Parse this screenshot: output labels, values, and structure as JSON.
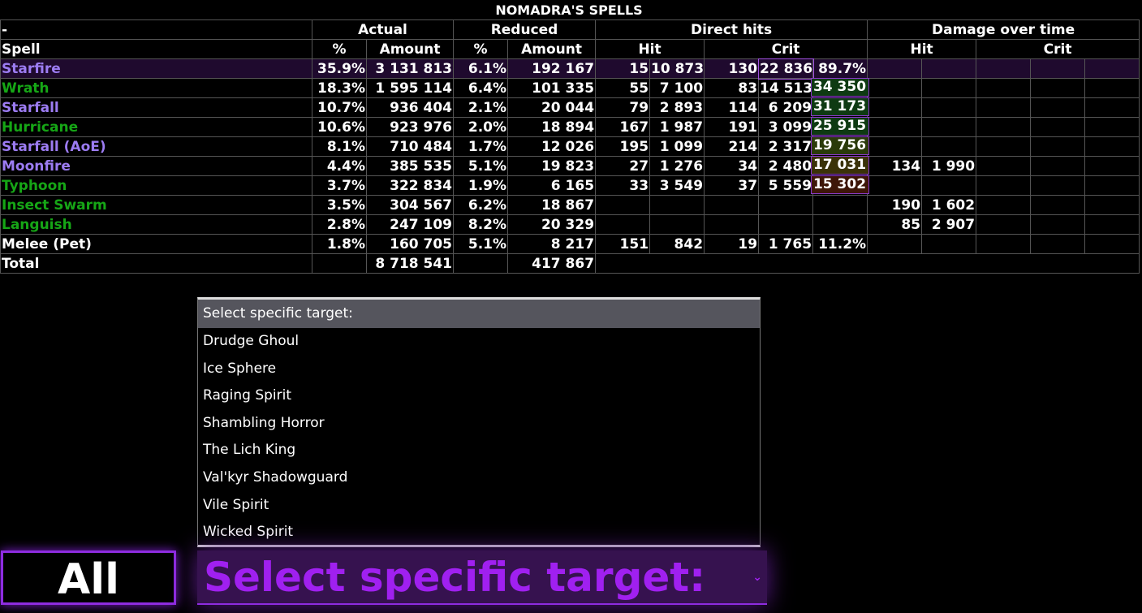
{
  "title": "NOMADRA'S SPELLS",
  "groups": {
    "dash": "-",
    "actual": "Actual",
    "reduced": "Reduced",
    "direct_hits": "Direct hits",
    "dot": "Damage over time"
  },
  "subheaders": {
    "spell": "Spell",
    "pct": "%",
    "amount": "Amount",
    "pct2": "%",
    "amount2": "Amount",
    "hit": "Hit",
    "crit": "Crit",
    "dot_hit": "Hit",
    "dot_crit": "Crit"
  },
  "rows": [
    {
      "name": "Starfire",
      "color": "#9c7cf2",
      "pct": "35.9%",
      "amount": "3 131 813",
      "rpct": "6.1%",
      "ramount": "192 167",
      "hit_n": "15",
      "hit_avg": "10 873",
      "crit_n": "130",
      "crit_avg": "22 836",
      "crit_pct": "89.7%",
      "max": "",
      "dot_hit_n": "",
      "dot_hit_avg": ""
    },
    {
      "name": "Wrath",
      "color": "#16a616",
      "pct": "18.3%",
      "amount": "1 595 114",
      "rpct": "6.4%",
      "ramount": "101 335",
      "hit_n": "55",
      "hit_avg": "7 100",
      "crit_n": "83",
      "crit_avg": "14 513",
      "crit_pct": "",
      "max": "34 350",
      "dot_hit_n": "",
      "dot_hit_avg": ""
    },
    {
      "name": "Starfall",
      "color": "#9c7cf2",
      "pct": "10.7%",
      "amount": "936 404",
      "rpct": "2.1%",
      "ramount": "20 044",
      "hit_n": "79",
      "hit_avg": "2 893",
      "crit_n": "114",
      "crit_avg": "6 209",
      "crit_pct": "",
      "max": "31 173",
      "dot_hit_n": "",
      "dot_hit_avg": ""
    },
    {
      "name": "Hurricane",
      "color": "#16a616",
      "pct": "10.6%",
      "amount": "923 976",
      "rpct": "2.0%",
      "ramount": "18 894",
      "hit_n": "167",
      "hit_avg": "1 987",
      "crit_n": "191",
      "crit_avg": "3 099",
      "crit_pct": "",
      "max": "25 915",
      "dot_hit_n": "",
      "dot_hit_avg": ""
    },
    {
      "name": "Starfall (AoE)",
      "color": "#9c7cf2",
      "pct": "8.1%",
      "amount": "710 484",
      "rpct": "1.7%",
      "ramount": "12 026",
      "hit_n": "195",
      "hit_avg": "1 099",
      "crit_n": "214",
      "crit_avg": "2 317",
      "crit_pct": "",
      "max": "19 756",
      "dot_hit_n": "",
      "dot_hit_avg": ""
    },
    {
      "name": "Moonfire",
      "color": "#9c7cf2",
      "pct": "4.4%",
      "amount": "385 535",
      "rpct": "5.1%",
      "ramount": "19 823",
      "hit_n": "27",
      "hit_avg": "1 276",
      "crit_n": "34",
      "crit_avg": "2 480",
      "crit_pct": "",
      "max": "17 031",
      "dot_hit_n": "134",
      "dot_hit_avg": "1 990"
    },
    {
      "name": "Typhoon",
      "color": "#16a616",
      "pct": "3.7%",
      "amount": "322 834",
      "rpct": "1.9%",
      "ramount": "6 165",
      "hit_n": "33",
      "hit_avg": "3 549",
      "crit_n": "37",
      "crit_avg": "5 559",
      "crit_pct": "",
      "max": "15 302",
      "dot_hit_n": "",
      "dot_hit_avg": ""
    },
    {
      "name": "Insect Swarm",
      "color": "#16a616",
      "pct": "3.5%",
      "amount": "304 567",
      "rpct": "6.2%",
      "ramount": "18 867",
      "hit_n": "",
      "hit_avg": "",
      "crit_n": "",
      "crit_avg": "",
      "crit_pct": "",
      "max": "",
      "dot_hit_n": "190",
      "dot_hit_avg": "1 602"
    },
    {
      "name": "Languish",
      "color": "#16a616",
      "pct": "2.8%",
      "amount": "247 109",
      "rpct": "8.2%",
      "ramount": "20 329",
      "hit_n": "",
      "hit_avg": "",
      "crit_n": "",
      "crit_avg": "",
      "crit_pct": "",
      "max": "",
      "dot_hit_n": "85",
      "dot_hit_avg": "2 907"
    },
    {
      "name": "Melee (Pet)",
      "color": "#ffffff",
      "pct": "1.8%",
      "amount": "160 705",
      "rpct": "5.1%",
      "ramount": "8 217",
      "hit_n": "151",
      "hit_avg": "842",
      "crit_n": "19",
      "crit_avg": "1 765",
      "crit_pct": "11.2%",
      "max": "",
      "dot_hit_n": "",
      "dot_hit_avg": ""
    }
  ],
  "max_colors": [
    "#0e3a12",
    "#0e3a12",
    "#0e3a12",
    "#2a3a0a",
    "#3a3208",
    "#3d1608",
    "#3d0a0a"
  ],
  "total": {
    "label": "Total",
    "amount": "8 718 541",
    "ramount": "417 867"
  },
  "dropdown": {
    "header": "Select specific target:",
    "items": [
      "Drudge Ghoul",
      "Ice Sphere",
      "Raging Spirit",
      "Shambling Horror",
      "The Lich King",
      "Val'kyr Shadowguard",
      "Vile Spirit",
      "Wicked Spirit"
    ]
  },
  "all_button": "All",
  "select_value": "Select specific target:",
  "chevron": "⌄"
}
